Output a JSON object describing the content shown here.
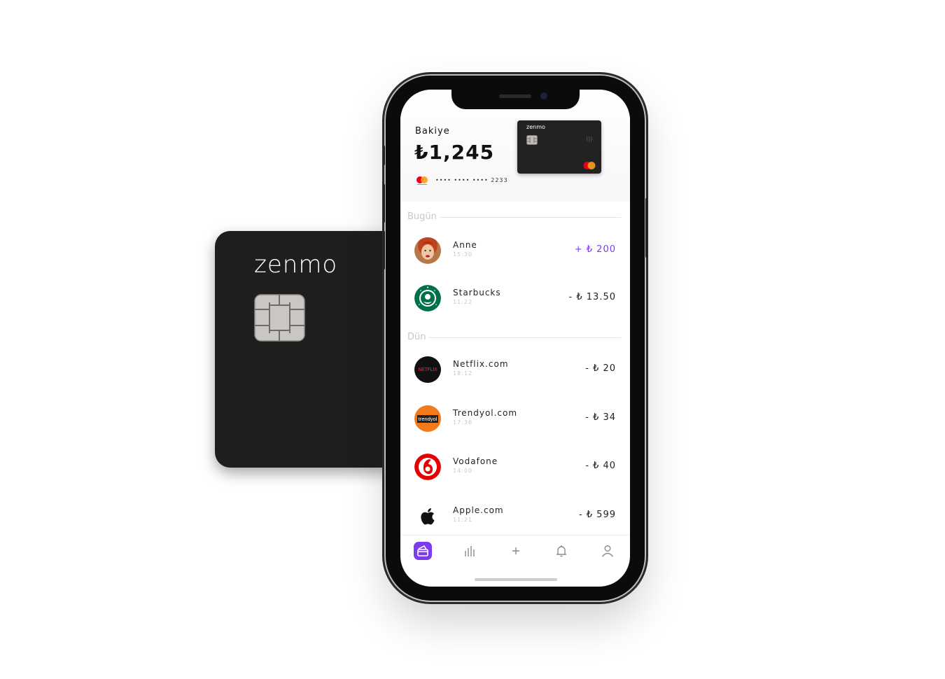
{
  "card": {
    "brand": "zenmo"
  },
  "phone": {
    "balance": {
      "label": "Bakiye",
      "amount": "₺1,245",
      "card_number": "•••• •••• •••• 2233"
    },
    "mini_card": {
      "brand": "zenmo"
    },
    "sections": [
      {
        "label": "Bugün"
      },
      {
        "label": "Dün"
      }
    ],
    "transactions": [
      {
        "name": "Anne",
        "time": "15:30",
        "amount": "+ ₺ 200",
        "logo": "avatar-photo"
      },
      {
        "name": "Starbucks",
        "time": "11:22",
        "amount": "- ₺ 13.50",
        "logo": "starbucks-logo"
      },
      {
        "name": "Netflix.com",
        "time": "18:12",
        "amount": "- ₺ 20",
        "logo": "netflix-logo",
        "logo_text": "NETFLIX"
      },
      {
        "name": "Trendyol.com",
        "time": "17:36",
        "amount": "- ₺ 34",
        "logo": "trendyol-logo",
        "logo_text": "trendyol"
      },
      {
        "name": "Vodafone",
        "time": "14:00",
        "amount": "- ₺ 40",
        "logo": "vodafone-logo"
      },
      {
        "name": "Apple.com",
        "time": "11:21",
        "amount": "- ₺ 599",
        "logo": "apple-logo"
      }
    ],
    "tabbar": [
      {
        "icon": "wallet-icon",
        "active": true
      },
      {
        "icon": "stats-icon",
        "active": false
      },
      {
        "icon": "plus-icon",
        "active": false
      },
      {
        "icon": "bell-icon",
        "active": false
      },
      {
        "icon": "profile-icon",
        "active": false
      }
    ],
    "colors": {
      "accent": "#7b3cf0",
      "card": "#1e1e1e"
    }
  }
}
